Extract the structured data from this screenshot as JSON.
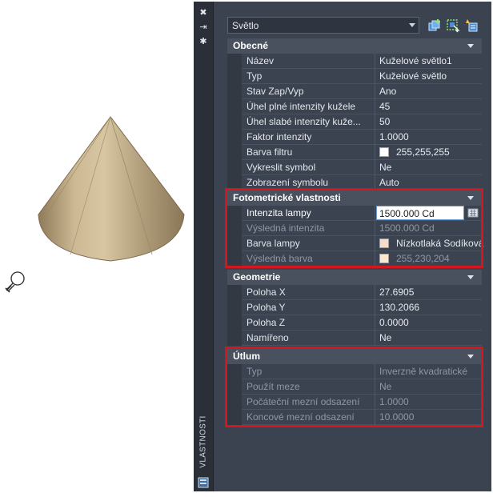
{
  "strip": {
    "title": "VLASTNOSTI",
    "close_glyph": "✖",
    "autohide_glyph": "⇥",
    "properties_glyph": "✱"
  },
  "selector": {
    "value": "Světlo"
  },
  "toolbar_icons": [
    "toggle-pickadd-icon",
    "select-objects-icon",
    "quick-select-icon"
  ],
  "sections": {
    "general": {
      "title": "Obecné",
      "rows": [
        {
          "label": "Název",
          "value": "Kuželové světlo1"
        },
        {
          "label": "Typ",
          "value": "Kuželové světlo"
        },
        {
          "label": "Stav Zap/Vyp",
          "value": "Ano"
        },
        {
          "label": "Úhel plné intenzity kužele",
          "value": "45"
        },
        {
          "label": "Úhel slabé intenzity kuže...",
          "value": "50"
        },
        {
          "label": "Faktor intenzity",
          "value": "1.0000"
        },
        {
          "label": "Barva filtru",
          "value": "255,255,255",
          "swatch": "#ffffff"
        },
        {
          "label": "Vykreslit symbol",
          "value": "Ne"
        },
        {
          "label": "Zobrazení symbolu",
          "value": "Auto"
        }
      ]
    },
    "photometric": {
      "title": "Fotometrické vlastnosti",
      "rows": [
        {
          "label": "Intenzita lampy",
          "value": "1500.000 Cd"
        },
        {
          "label": "Výsledná intenzita",
          "value": "1500.000 Cd"
        },
        {
          "label": "Barva lampy",
          "value": "Nízkotlaká Sodíková",
          "swatch": "#f7dcc8"
        },
        {
          "label": "Výsledná barva",
          "value": "255,230,204",
          "swatch": "#ffe6cc"
        }
      ]
    },
    "geometry": {
      "title": "Geometrie",
      "rows": [
        {
          "label": "Poloha X",
          "value": "27.6905"
        },
        {
          "label": "Poloha Y",
          "value": "130.2066"
        },
        {
          "label": "Poloha Z",
          "value": "0.0000"
        },
        {
          "label": "Namířeno",
          "value": "Ne"
        }
      ]
    },
    "attenuation": {
      "title": "Útlum",
      "rows": [
        {
          "label": "Typ",
          "value": "Inverzně kvadratické"
        },
        {
          "label": "Použít meze",
          "value": "Ne"
        },
        {
          "label": "Počáteční mezní odsazení",
          "value": "1.0000"
        },
        {
          "label": "Koncové mezní odsazení",
          "value": "10.0000"
        }
      ]
    }
  },
  "colors": {
    "highlight_frame": "#d4161f",
    "panel_bg": "#3b4350",
    "section_header_bg": "#49515f"
  }
}
